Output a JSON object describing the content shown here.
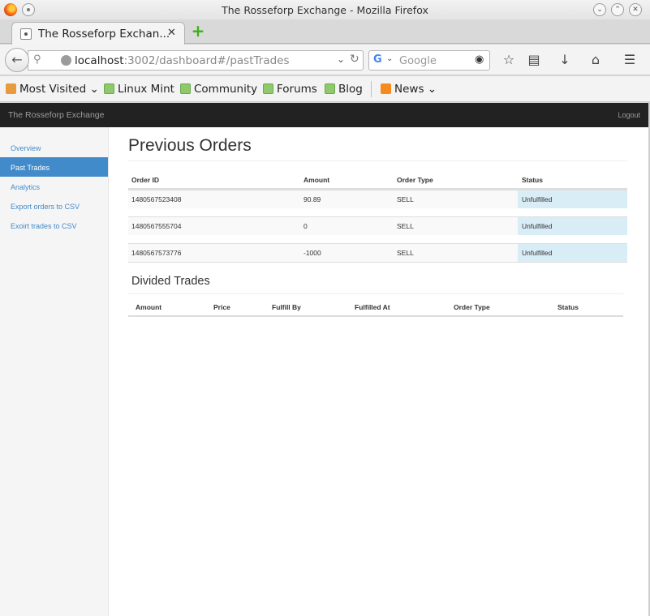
{
  "window": {
    "title": "The Rosseforp Exchange - Mozilla Firefox"
  },
  "browser": {
    "tab_title": "The Rosseforp Exchan...",
    "url_host": "localhost",
    "url_rest": ":3002/dashboard#/pastTrades",
    "search_placeholder": "Google",
    "bookmarks": [
      {
        "label": "Most Visited",
        "icon": "folder-icon"
      },
      {
        "label": "Linux Mint",
        "icon": "mint-icon"
      },
      {
        "label": "Community",
        "icon": "mint-icon"
      },
      {
        "label": "Forums",
        "icon": "mint-icon"
      },
      {
        "label": "Blog",
        "icon": "mint-icon"
      },
      {
        "label": "News",
        "icon": "rss-icon"
      }
    ]
  },
  "app": {
    "brand": "The Rosseforp Exchange",
    "logout": "Logout",
    "sidebar": [
      {
        "label": "Overview",
        "active": false
      },
      {
        "label": "Past Trades",
        "active": true
      },
      {
        "label": "Analytics",
        "active": false
      },
      {
        "label": "Export orders to CSV",
        "active": false
      },
      {
        "label": "Exoirt trades to CSV",
        "active": false
      }
    ],
    "page_title": "Previous Orders",
    "orders": {
      "headers": [
        "Order ID",
        "Amount",
        "Order Type",
        "Status"
      ],
      "rows": [
        {
          "id": "1480567523408",
          "amount": "90.89",
          "type": "SELL",
          "status": "Unfulfilled"
        },
        {
          "id": "1480567555704",
          "amount": "0",
          "type": "SELL",
          "status": "Unfulfilled"
        },
        {
          "id": "1480567573776",
          "amount": "-1000",
          "type": "SELL",
          "status": "Unfulfilled"
        }
      ]
    },
    "trades_title": "Divided Trades",
    "trades": {
      "headers": [
        "Amount",
        "Price",
        "Fulfill By",
        "Fulfilled At",
        "Order Type",
        "Status"
      ]
    }
  },
  "colors": {
    "navbar_bg": "#222222",
    "sidebar_active": "#428bca",
    "status_cell": "#d9edf7"
  }
}
